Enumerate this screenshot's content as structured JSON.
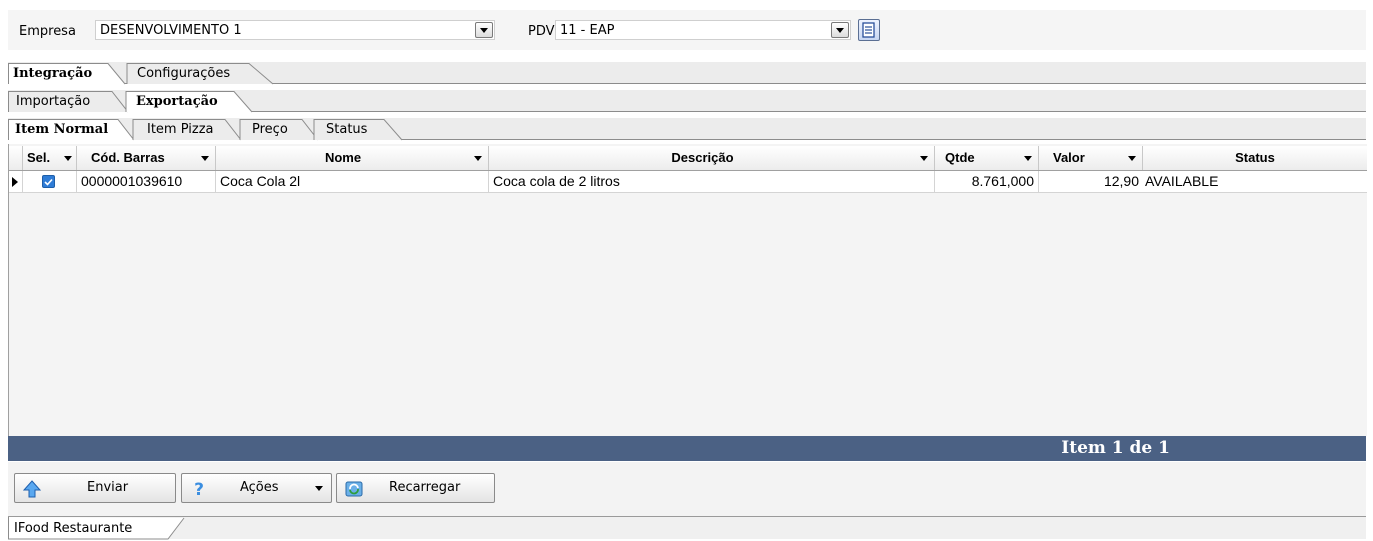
{
  "filters": {
    "empresa_label": "Empresa",
    "empresa_value": "DESENVOLVIMENTO 1",
    "pdv_label": "PDV",
    "pdv_value": "11 - EAP"
  },
  "tabs_level1": [
    "Integração",
    "Configurações"
  ],
  "tabs_level2": [
    "Importação",
    "Exportação"
  ],
  "tabs_level3": [
    "Item Normal",
    "Item Pizza",
    "Preço",
    "Status"
  ],
  "grid": {
    "columns": [
      "Sel.",
      "Cód. Barras",
      "Nome",
      "Descrição",
      "Qtde",
      "Valor",
      "Status"
    ],
    "rows": [
      {
        "selected": true,
        "cod_barras": "0000001039610",
        "nome": "Coca Cola 2l",
        "descricao": "Coca cola de 2 litros",
        "qtde": "8.761,000",
        "valor": "12,90",
        "status": "AVAILABLE"
      }
    ]
  },
  "pager_text": "Item 1 de 1",
  "actions": {
    "enviar": "Enviar",
    "acoes": "Ações",
    "recarregar": "Recarregar"
  },
  "bottom_tab": "IFood Restaurante",
  "colors": {
    "footer_bar": "#4b6184",
    "checkbox": "#2f7cd6"
  }
}
